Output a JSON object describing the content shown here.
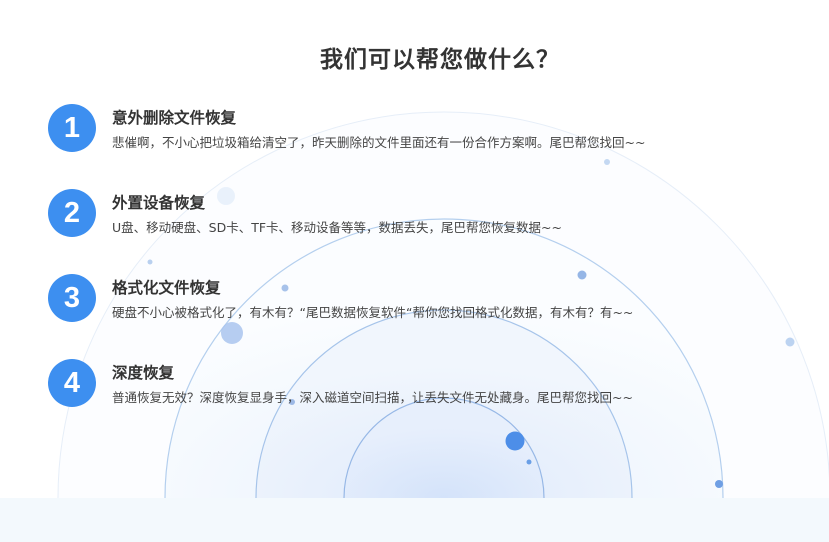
{
  "page": {
    "title": "我们可以帮您做什么？"
  },
  "features": [
    {
      "number": "1",
      "title": "意外删除文件恢复",
      "description": "悲催啊，不小心把垃圾箱给清空了，昨天删除的文件里面还有一份合作方案啊。尾巴帮您找回~~"
    },
    {
      "number": "2",
      "title": "外置设备恢复",
      "description": "U盘、移动硬盘、SD卡、TF卡、移动设备等等，数据丢失，尾巴帮您恢复数据~~"
    },
    {
      "number": "3",
      "title": "格式化文件恢复",
      "description": "硬盘不小心被格式化了，有木有？“尾巴数据恢复软件“帮你您找回格式化数据，有木有？有~~"
    },
    {
      "number": "4",
      "title": "深度恢复",
      "description": "普通恢复无效？深度恢复显身手，深入磁道空间扫描，让丢失文件无处藏身。尾巴帮您找回~~"
    }
  ],
  "colors": {
    "accent": "#3d8ff0",
    "title_text": "#333333",
    "desc_text": "#444444",
    "arc_stroke": "#a9c8ec",
    "bottom_band": "#f3f9fd"
  }
}
